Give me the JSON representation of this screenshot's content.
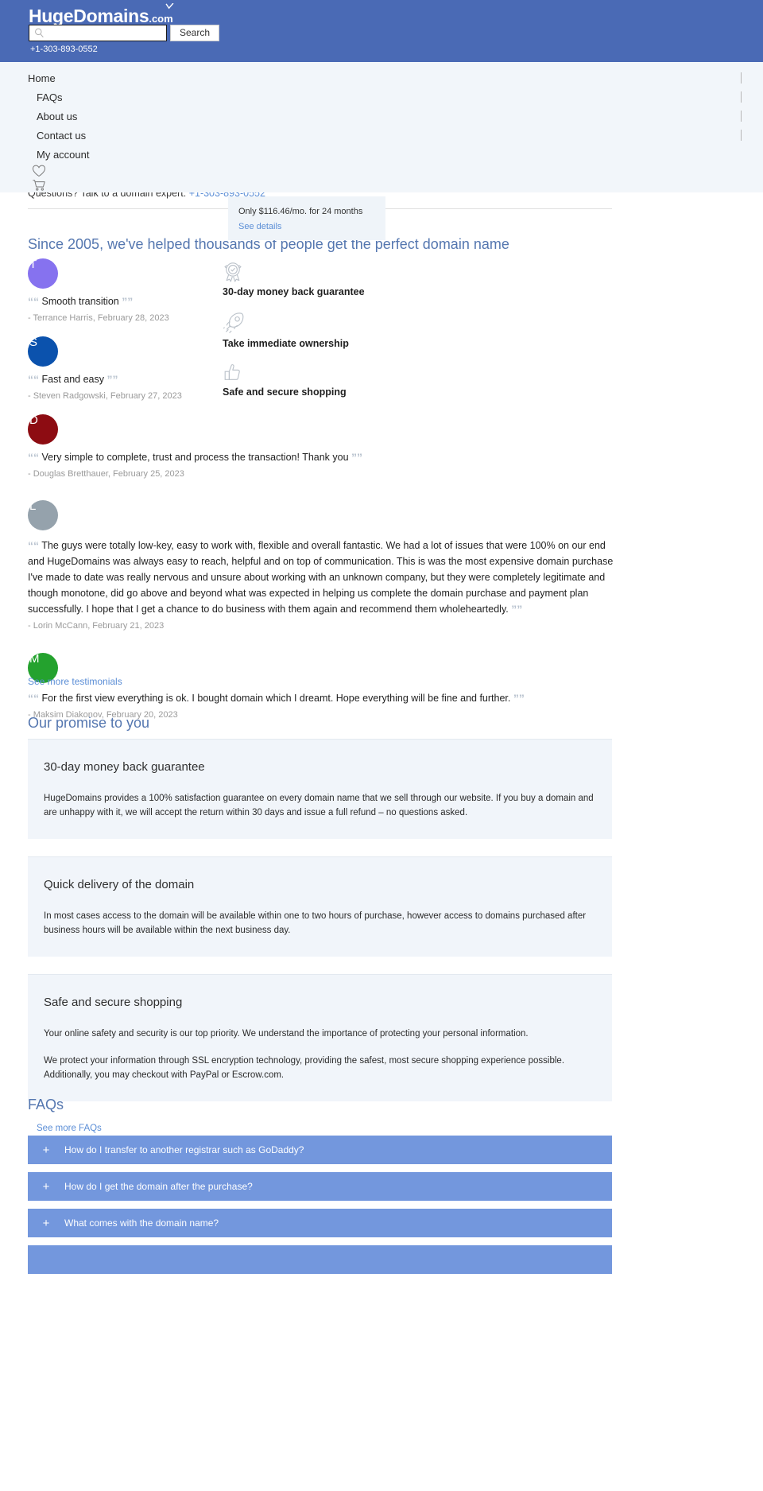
{
  "header": {
    "logo_main": "HugeDomains",
    "logo_tld": ".com",
    "search_placeholder": "",
    "search_value": "",
    "search_button": "Search",
    "phone": "+1-303-893-0552"
  },
  "nav": {
    "items": [
      {
        "label": "Home"
      },
      {
        "label": "FAQs"
      },
      {
        "label": "About us"
      },
      {
        "label": "Contact us"
      },
      {
        "label": "My account"
      }
    ],
    "icons": [
      "heart-icon",
      "cart-icon"
    ]
  },
  "expert": {
    "text": "Questions? Talk to a domain expert:",
    "phone": "+1-303-893-0552"
  },
  "price_popup": {
    "text": "Only $116.46/mo. for 24 months",
    "link": "See details"
  },
  "testimonials_section": {
    "heading": "Since 2005, we've helped thousands of people get the perfect domain name",
    "see_more": "See more testimonials",
    "items": [
      {
        "initial": "T",
        "color": "#8672ef",
        "quote": "Smooth transition",
        "by": "- Terrance Harris, February 28, 2023"
      },
      {
        "initial": "S",
        "color": "#0b52ad",
        "quote": "Fast and easy",
        "by": "- Steven Radgowski, February 27, 2023"
      },
      {
        "initial": "D",
        "color": "#8d0c12",
        "quote": "Very simple to complete, trust and process the transaction! Thank you",
        "by": "- Douglas Bretthauer, February 25, 2023"
      },
      {
        "initial": "L",
        "color": "#95a2ac",
        "quote": "The guys were totally low-key, easy to work with, flexible and overall fantastic. We had a lot of issues that were 100% on our end and HugeDomains was always easy to reach, helpful and on top of communication. This is was the most expensive domain purchase I've made to date was really nervous and unsure about working with an unknown company, but they were completely legitimate and though monotone, did go above and beyond what was expected in helping us complete the domain purchase and payment plan successfully. I hope that I get a chance to do business with them again and recommend them wholeheartedly.",
        "by": "- Lorin McCann, February 21, 2023"
      },
      {
        "initial": "M",
        "color": "#24a22e",
        "quote": "For the first view everything is ok. I bought domain which I dreamt. Hope everything will be fine and further.",
        "by": "- Maksim Diakonov, February 20, 2023"
      }
    ]
  },
  "benefits": [
    {
      "icon": "badge-icon",
      "label": "30-day money back guarantee"
    },
    {
      "icon": "rocket-icon",
      "label": "Take immediate ownership"
    },
    {
      "icon": "thumbs-up-icon",
      "label": "Safe and secure shopping"
    }
  ],
  "promise": {
    "heading": "Our promise to you",
    "cards": [
      {
        "title": "30-day money back guarantee",
        "paragraphs": [
          "HugeDomains provides a 100% satisfaction guarantee on every domain name that we sell through our website. If you buy a domain and are unhappy with it, we will accept the return within 30 days and issue a full refund – no questions asked."
        ]
      },
      {
        "title": "Quick delivery of the domain",
        "paragraphs": [
          "In most cases access to the domain will be available within one to two hours of purchase, however access to domains purchased after business hours will be available within the next business day."
        ]
      },
      {
        "title": "Safe and secure shopping",
        "paragraphs": [
          "Your online safety and security is our top priority. We understand the importance of protecting your personal information.",
          "We protect your information through SSL encryption technology, providing the safest, most secure shopping experience possible. Additionally, you may checkout with PayPal or Escrow.com."
        ]
      }
    ]
  },
  "faqs": {
    "heading": "FAQs",
    "see_more": "See more FAQs",
    "expand_glyph": "+",
    "items": [
      {
        "question": "How do I transfer to another registrar such as GoDaddy?"
      },
      {
        "question": "How do I get the domain after the purchase?"
      },
      {
        "question": "What comes with the domain name?"
      },
      {
        "question": ""
      }
    ]
  },
  "colors": {
    "brand_blue": "#4a6ab5",
    "nav_bg": "#f2f6fa",
    "link": "#5b8ed6",
    "heading": "#5577b0",
    "card_bg": "#f1f5fa",
    "faq_row": "#7397dd"
  }
}
